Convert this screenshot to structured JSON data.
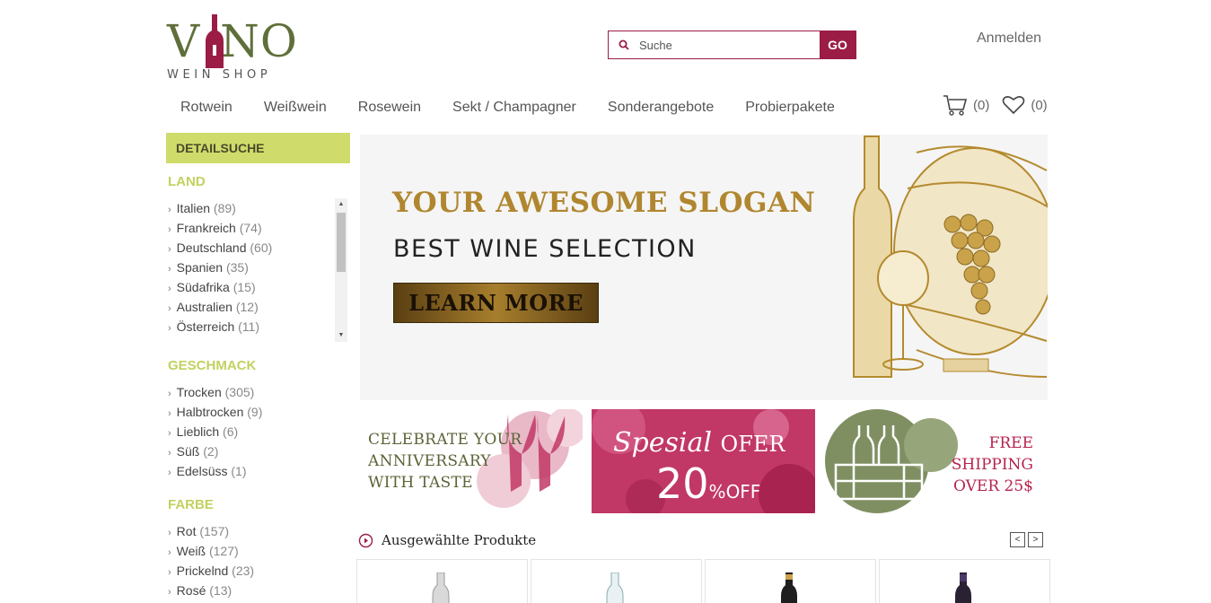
{
  "logo": {
    "word": "VINO",
    "sub": "WEIN SHOP"
  },
  "search": {
    "placeholder": "Suche",
    "go_label": "GO"
  },
  "header": {
    "login_label": "Anmelden"
  },
  "nav": [
    "Rotwein",
    "Weißwein",
    "Rosewein",
    "Sekt / Champagner",
    "Sonderangebote",
    "Probierpakete"
  ],
  "cart": {
    "cart_count": "(0)",
    "wishlist_count": "(0)"
  },
  "sidebar": {
    "detail_label": "DETAILSUCHE",
    "land": {
      "title": "LAND",
      "items": [
        {
          "name": "Italien",
          "count": "(89)"
        },
        {
          "name": "Frankreich",
          "count": "(74)"
        },
        {
          "name": "Deutschland",
          "count": "(60)"
        },
        {
          "name": "Spanien",
          "count": "(35)"
        },
        {
          "name": "Südafrika",
          "count": "(15)"
        },
        {
          "name": "Australien",
          "count": "(12)"
        },
        {
          "name": "Österreich",
          "count": "(11)"
        }
      ]
    },
    "geschmack": {
      "title": "GESCHMACK",
      "items": [
        {
          "name": "Trocken",
          "count": "(305)"
        },
        {
          "name": "Halbtrocken",
          "count": "(9)"
        },
        {
          "name": "Lieblich",
          "count": "(6)"
        },
        {
          "name": "Süß",
          "count": "(2)"
        },
        {
          "name": "Edelsüss",
          "count": "(1)"
        }
      ]
    },
    "farbe": {
      "title": "FARBE",
      "items": [
        {
          "name": "Rot",
          "count": "(157)"
        },
        {
          "name": "Weiß",
          "count": "(127)"
        },
        {
          "name": "Prickelnd",
          "count": "(23)"
        },
        {
          "name": "Rosé",
          "count": "(13)"
        }
      ]
    }
  },
  "hero": {
    "slogan": "YOUR AWESOME SLOGAN",
    "subtitle": "BEST WINE SELECTION",
    "button_label": "LEARN MORE"
  },
  "promos": {
    "p1": {
      "line1": "CELEBRATE YOUR",
      "line2": "ANNIVERSARY",
      "line3": "WITH TASTE"
    },
    "p2": {
      "script": "Spesial",
      "ofer": "OFER",
      "number": "20",
      "percent": "%",
      "off": "OFF"
    },
    "p3": {
      "line1": "FREE",
      "line2": "SHIPPING",
      "line3": "OVER 25$"
    }
  },
  "featured": {
    "title": "Ausgewählte Produkte",
    "prev": "<",
    "next": ">"
  },
  "colors": {
    "accent": "#9b1c45",
    "lime": "#cfdc6b",
    "olive": "#5f6f3a",
    "gold": "#b0862f"
  }
}
